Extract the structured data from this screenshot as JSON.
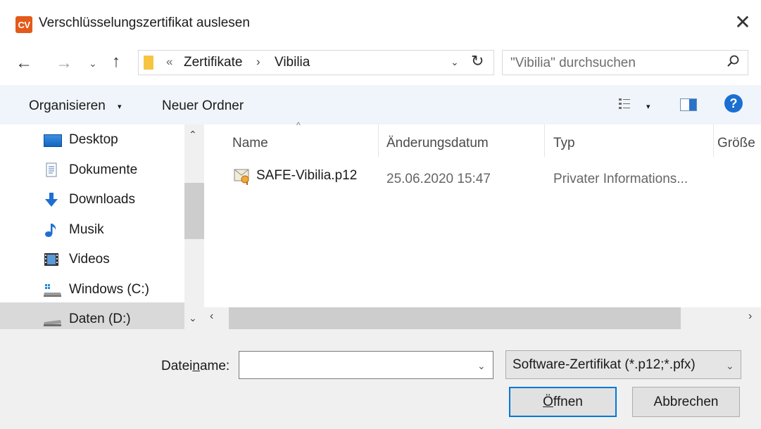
{
  "window": {
    "app_logo_text": "CV",
    "title": "Verschlüsselungszertifikat auslesen",
    "close_glyph": "✕"
  },
  "nav": {
    "back_glyph": "←",
    "forward_glyph": "→",
    "recent_glyph": "⌄",
    "up_glyph": "↑",
    "path_overflow": "«",
    "path": [
      "Zertifikate",
      "Vibilia"
    ],
    "path_separator": "›",
    "dropdown_glyph": "⌄",
    "refresh_glyph": "↻",
    "search_placeholder": "\"Vibilia\" durchsuchen",
    "search_glyph": "⚲"
  },
  "toolbar": {
    "organize_label": "Organisieren",
    "organize_caret": "▾",
    "new_folder_label": "Neuer Ordner",
    "view_caret": "▾",
    "help_glyph": "?"
  },
  "sidebar": {
    "items": [
      {
        "label": "Desktop",
        "icon": "desktop-icon"
      },
      {
        "label": "Dokumente",
        "icon": "documents-icon"
      },
      {
        "label": "Downloads",
        "icon": "downloads-icon"
      },
      {
        "label": "Musik",
        "icon": "music-icon"
      },
      {
        "label": "Videos",
        "icon": "videos-icon"
      },
      {
        "label": "Windows (C:)",
        "icon": "drive-c-icon"
      },
      {
        "label": "Daten (D:)",
        "icon": "drive-d-icon",
        "selected": true
      }
    ],
    "scroll_up_glyph": "⌃",
    "scroll_down_glyph": "⌄"
  },
  "files": {
    "columns": [
      "Name",
      "Änderungsdatum",
      "Typ",
      "Größe"
    ],
    "sort_glyph": "^",
    "rows": [
      {
        "name": "SAFE-Vibilia.p12",
        "date": "25.06.2020 15:47",
        "type": "Privater Informations..."
      }
    ],
    "hscroll_left_glyph": "‹",
    "hscroll_right_glyph": "›"
  },
  "footer": {
    "filename_label_pre": "Datei",
    "filename_label_underlined": "n",
    "filename_label_post": "ame:",
    "filename_value": "",
    "filename_dd_glyph": "⌄",
    "filter_value": "Software-Zertifikat (*.p12;*.pfx)",
    "filter_dd_glyph": "⌄",
    "open_pre": "",
    "open_underlined": "Ö",
    "open_post": "ffnen",
    "cancel_label": "Abbrechen"
  },
  "colors": {
    "accent": "#0078d7",
    "toolbar_bg": "#f0f5fb",
    "logo": "#e35a1a"
  }
}
